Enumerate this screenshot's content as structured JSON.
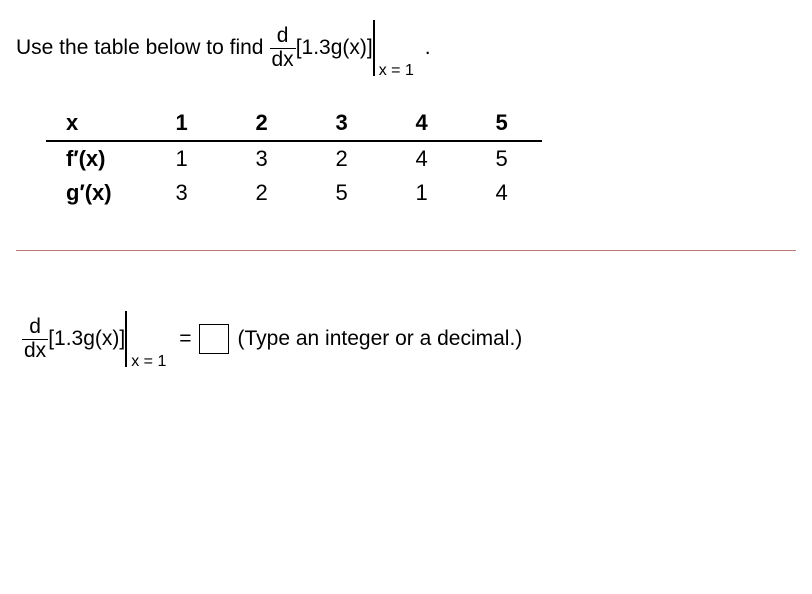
{
  "prompt": {
    "prefix": "Use the table below to find",
    "frac_num": "d",
    "frac_den": "dx",
    "expr": "[1.3g(x)]",
    "eval_at": "x = 1",
    "suffix": "."
  },
  "table": {
    "header_label": "x",
    "headers": [
      "1",
      "2",
      "3",
      "4",
      "5"
    ],
    "rows": [
      {
        "label": "f′(x)",
        "cells": [
          "1",
          "3",
          "2",
          "4",
          "5"
        ]
      },
      {
        "label": "g′(x)",
        "cells": [
          "3",
          "2",
          "5",
          "1",
          "4"
        ]
      }
    ]
  },
  "answer": {
    "frac_num": "d",
    "frac_den": "dx",
    "expr": "[1.3g(x)]",
    "eval_at": "x = 1",
    "equals": "=",
    "hint": "(Type an integer or a decimal.)"
  },
  "chart_data": {
    "type": "table",
    "columns": [
      "x",
      "1",
      "2",
      "3",
      "4",
      "5"
    ],
    "rows": [
      [
        "f'(x)",
        1,
        3,
        2,
        4,
        5
      ],
      [
        "g'(x)",
        3,
        2,
        5,
        1,
        4
      ]
    ]
  }
}
